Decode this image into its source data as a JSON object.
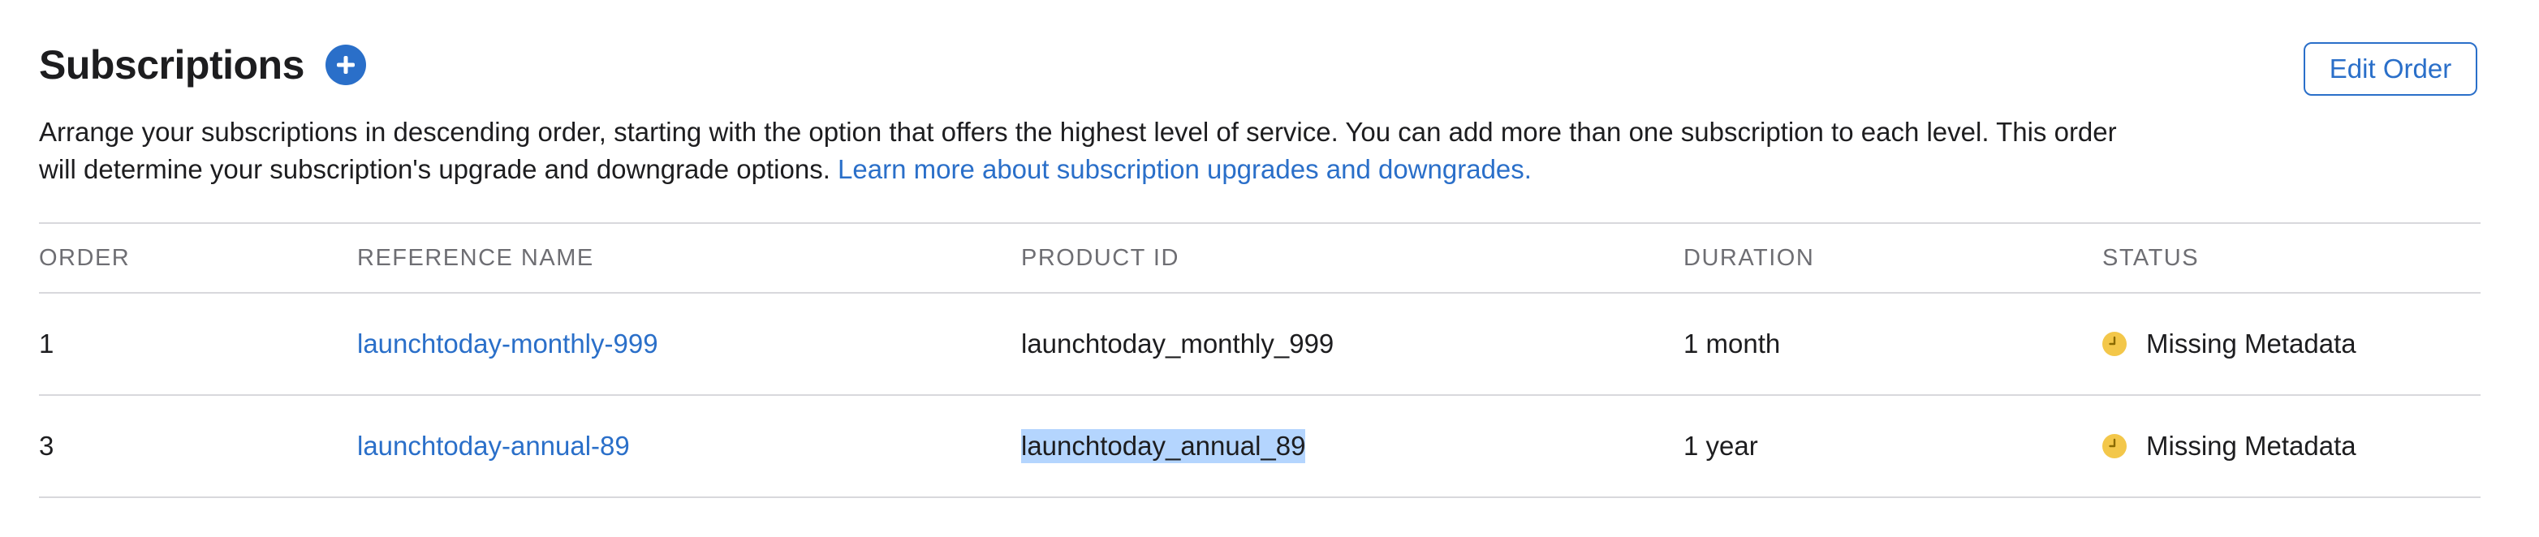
{
  "header": {
    "title": "Subscriptions",
    "add_icon": "plus-circle-icon",
    "edit_order_label": "Edit Order"
  },
  "description": {
    "line1": "Arrange your subscriptions in descending order, starting with the option that offers the highest level of service. You can add more than one subscription to each level. This order",
    "line2": "will determine your subscription's upgrade and downgrade options.",
    "link_text": "Learn more about subscription upgrades and downgrades."
  },
  "table": {
    "columns": [
      "ORDER",
      "REFERENCE NAME",
      "PRODUCT ID",
      "DURATION",
      "STATUS"
    ],
    "rows": [
      {
        "order": "1",
        "reference_name": "launchtoday-monthly-999",
        "product_id": "launchtoday_monthly_999",
        "duration": "1 month",
        "status": "Missing Metadata",
        "status_icon": "clock-icon"
      },
      {
        "order": "3",
        "reference_name": "launchtoday-annual-89",
        "product_id": "launchtoday_annual_89",
        "duration": "1 year",
        "status": "Missing Metadata",
        "status_icon": "clock-icon"
      }
    ]
  },
  "colors": {
    "accent": "#2a6fc9",
    "status_warning": "#f3c74a",
    "selection": "#b4d5fe",
    "divider": "#d8d8dc"
  }
}
